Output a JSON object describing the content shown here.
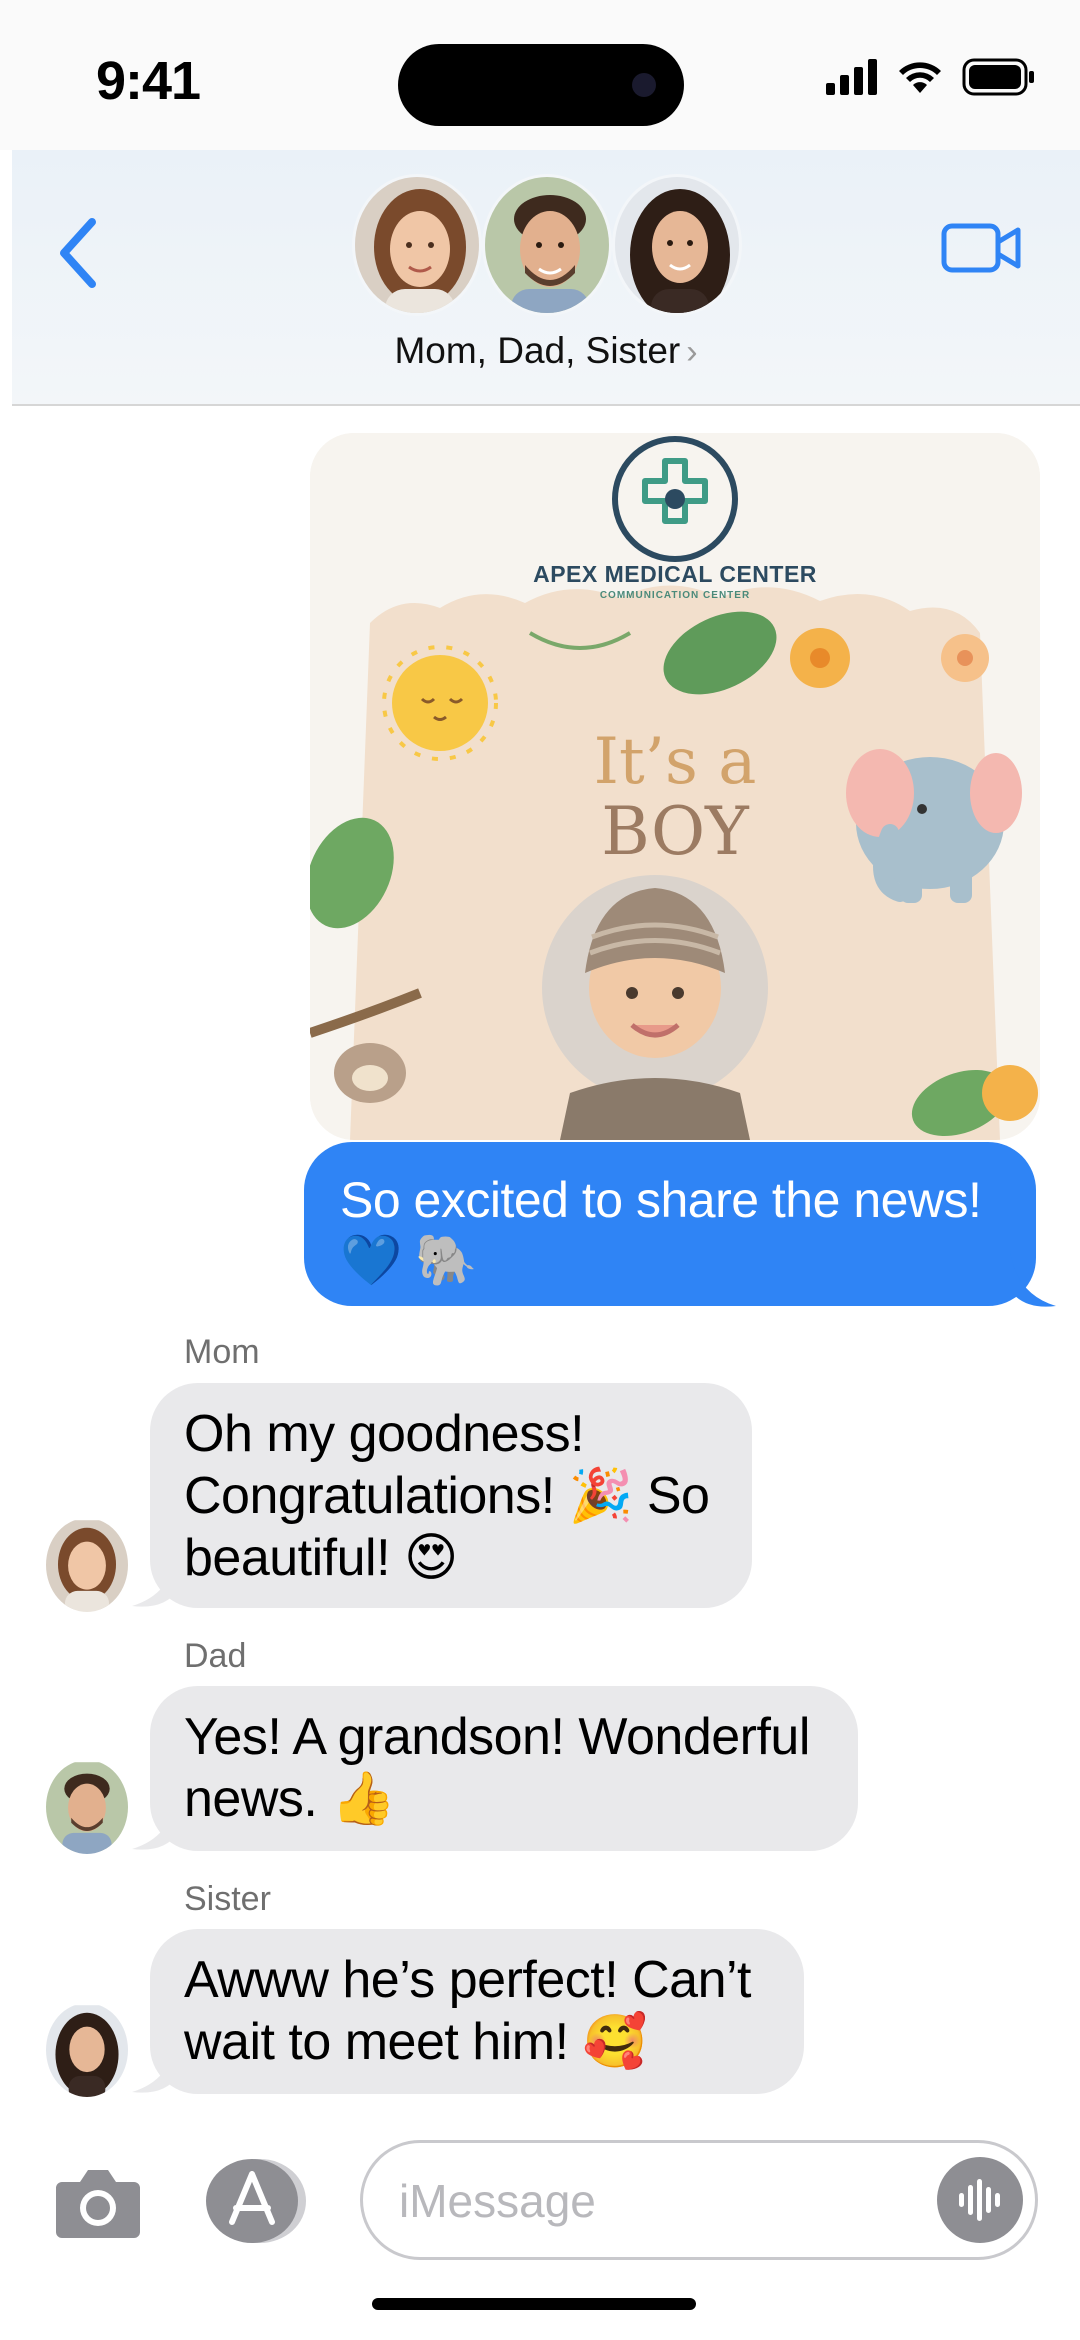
{
  "status_bar": {
    "time": "9:41"
  },
  "header": {
    "names": "Mom, Dad, Sister",
    "chevron": "›"
  },
  "announcement": {
    "logo_title": "APEX MEDICAL CENTER",
    "logo_subtitle": "COMMUNICATION CENTER",
    "headline_line1": "It’s a",
    "headline_line2": "BOY"
  },
  "messages": {
    "sent": {
      "line1": "So excited to share the news!",
      "line2": "💙 🐘"
    },
    "mom": {
      "sender": "Mom",
      "line1": "Oh my goodness!",
      "line2": "Congratulations! 🎉 So",
      "line3": "beautiful! 😍"
    },
    "dad": {
      "sender": "Dad",
      "line1": "Yes! A grandson! Wonderful",
      "line2": "news. 👍"
    },
    "sister": {
      "sender": "Sister",
      "line1": "Awww he’s perfect! Can’t",
      "line2": "wait to meet him! 🥰"
    }
  },
  "input": {
    "placeholder": "iMessage"
  },
  "icons": {
    "back": "chevron-left-icon",
    "video": "video-camera-icon",
    "camera": "camera-icon",
    "apps": "app-store-icon",
    "audio": "waveform-icon"
  },
  "colors": {
    "accent": "#2f84f5",
    "received_bubble": "#e9e9eb",
    "sent_bubble": "#2f84f5"
  }
}
